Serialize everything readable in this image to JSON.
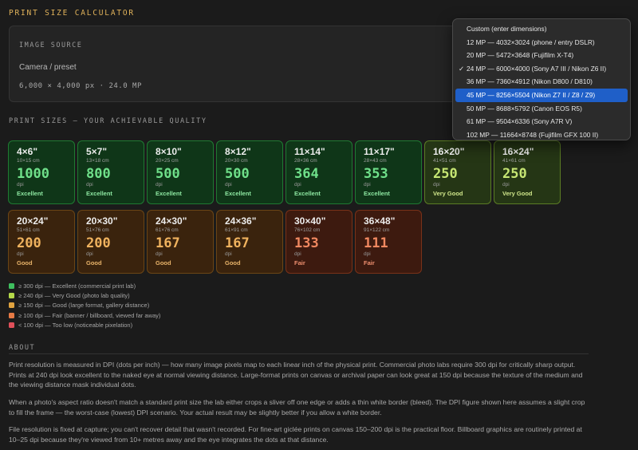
{
  "app": {
    "title": "PRINT SIZE CALCULATOR"
  },
  "image_source": {
    "heading": "IMAGE SOURCE",
    "select_value": "Camera / preset",
    "meta": "6,000 × 4,000 px  ·  24.0 MP"
  },
  "dropdown": {
    "options": [
      {
        "label": "Custom (enter dimensions)",
        "checked": false,
        "highlighted": false
      },
      {
        "label": "12 MP — 4032×3024 (phone / entry DSLR)",
        "checked": false,
        "highlighted": false
      },
      {
        "label": "20 MP — 5472×3648 (Fujifilm X-T4)",
        "checked": false,
        "highlighted": false
      },
      {
        "label": "24 MP — 6000×4000 (Sony A7 III / Nikon Z6 II)",
        "checked": true,
        "highlighted": false
      },
      {
        "label": "36 MP — 7360×4912 (Nikon D800 / D810)",
        "checked": false,
        "highlighted": false
      },
      {
        "label": "45 MP — 8256×5504 (Nikon Z7 II / Z8 / Z9)",
        "checked": false,
        "highlighted": true
      },
      {
        "label": "50 MP — 8688×5792 (Canon EOS R5)",
        "checked": false,
        "highlighted": false
      },
      {
        "label": "61 MP — 9504×6336 (Sony A7R V)",
        "checked": false,
        "highlighted": false
      },
      {
        "label": "102 MP — 11664×8748 (Fujifilm GFX 100 II)",
        "checked": false,
        "highlighted": false
      }
    ]
  },
  "print_sizes": {
    "heading": "PRINT SIZES — YOUR ACHIEVABLE QUALITY",
    "unit": "dpi",
    "cards": [
      {
        "size": "4×6\"",
        "cm": "10×15 cm",
        "dpi": "1000",
        "quality": "Excellent",
        "tier": "excellent"
      },
      {
        "size": "5×7\"",
        "cm": "13×18 cm",
        "dpi": "800",
        "quality": "Excellent",
        "tier": "excellent"
      },
      {
        "size": "8×10\"",
        "cm": "20×25 cm",
        "dpi": "500",
        "quality": "Excellent",
        "tier": "excellent"
      },
      {
        "size": "8×12\"",
        "cm": "20×30 cm",
        "dpi": "500",
        "quality": "Excellent",
        "tier": "excellent"
      },
      {
        "size": "11×14\"",
        "cm": "28×36 cm",
        "dpi": "364",
        "quality": "Excellent",
        "tier": "excellent"
      },
      {
        "size": "11×17\"",
        "cm": "28×43 cm",
        "dpi": "353",
        "quality": "Excellent",
        "tier": "excellent"
      },
      {
        "size": "16×20\"",
        "cm": "41×51 cm",
        "dpi": "250",
        "quality": "Very Good",
        "tier": "verygood"
      },
      {
        "size": "16×24\"",
        "cm": "41×61 cm",
        "dpi": "250",
        "quality": "Very Good",
        "tier": "verygood"
      },
      {
        "size": "20×24\"",
        "cm": "51×61 cm",
        "dpi": "200",
        "quality": "Good",
        "tier": "good"
      },
      {
        "size": "20×30\"",
        "cm": "51×76 cm",
        "dpi": "200",
        "quality": "Good",
        "tier": "good"
      },
      {
        "size": "24×30\"",
        "cm": "61×76 cm",
        "dpi": "167",
        "quality": "Good",
        "tier": "good"
      },
      {
        "size": "24×36\"",
        "cm": "61×91 cm",
        "dpi": "167",
        "quality": "Good",
        "tier": "good"
      },
      {
        "size": "30×40\"",
        "cm": "76×102 cm",
        "dpi": "133",
        "quality": "Fair",
        "tier": "fair"
      },
      {
        "size": "36×48\"",
        "cm": "91×122 cm",
        "dpi": "111",
        "quality": "Fair",
        "tier": "fair"
      }
    ]
  },
  "legend": [
    {
      "text": "≥ 300 dpi — Excellent (commercial print lab)",
      "color": "#3fbf5f"
    },
    {
      "text": "≥ 240 dpi — Very Good (photo lab quality)",
      "color": "#b5d94a"
    },
    {
      "text": "≥ 150 dpi — Good (large format, gallery distance)",
      "color": "#e0a340"
    },
    {
      "text": "≥ 100 dpi — Fair (banner / billboard, viewed far away)",
      "color": "#e67a45"
    },
    {
      "text": "< 100 dpi — Too low (noticeable pixelation)",
      "color": "#e0505a"
    }
  ],
  "about": {
    "heading": "ABOUT",
    "paragraphs": [
      "Print resolution is measured in DPI (dots per inch) — how many image pixels map to each linear inch of the physical print. Commercial photo labs require 300 dpi for critically sharp output. Prints at 240 dpi look excellent to the naked eye at normal viewing distance. Large-format prints on canvas or archival paper can look great at 150 dpi because the texture of the medium and the viewing distance mask individual dots.",
      "When a photo's aspect ratio doesn't match a standard print size the lab either crops a sliver off one edge or adds a thin white border (bleed). The DPI figure shown here assumes a slight crop to fill the frame — the worst-case (lowest) DPI scenario. Your actual result may be slightly better if you allow a white border.",
      "File resolution is fixed at capture; you can't recover detail that wasn't recorded. For fine-art giclée prints on canvas 150–200 dpi is the practical floor. Billboard graphics are routinely printed at 10–25 dpi because they're viewed from 10+ metres away and the eye integrates the dots at that distance."
    ]
  }
}
